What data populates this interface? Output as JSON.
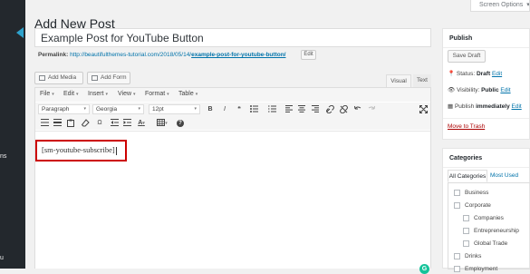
{
  "sidebar": {
    "frag1": "ns",
    "frag2": "u"
  },
  "header": {
    "title": "Add New Post",
    "screen_options": "Screen Options",
    "screen_options_caret": "▾"
  },
  "post": {
    "title": "Example Post for YouTube Button",
    "permalink_label": "Permalink:",
    "permalink_base": "http://beautifulthemes-tutorial.com/2018/05/14/",
    "permalink_slug": "example-post-for-youtube-button/",
    "edit_label": "Edit"
  },
  "media": {
    "add_media": "Add Media",
    "add_form": "Add Form"
  },
  "editor_tabs": {
    "visual": "Visual",
    "text": "Text"
  },
  "menubar": [
    "File",
    "Edit",
    "Insert",
    "View",
    "Format",
    "Table"
  ],
  "menubar_caret": "▾",
  "toolbar": {
    "format": "Paragraph",
    "font": "Georgia",
    "size": "12pt",
    "caret": "▾",
    "bold": "B",
    "italic": "I",
    "quote": "❝",
    "omega": "Ω",
    "text_color": "A",
    "help": "?"
  },
  "content": {
    "shortcode": "[sm-youtube-subscribe]",
    "grammarly": "G"
  },
  "publish": {
    "title": "Publish",
    "save_draft": "Save Draft",
    "status_label": "Status:",
    "status_value": "Draft",
    "visibility_label": "Visibility:",
    "visibility_value": "Public",
    "publish_label": "Publish",
    "publish_value": "immediately",
    "edit": "Edit",
    "trash": "Move to Trash"
  },
  "categories": {
    "title": "Categories",
    "tab_all": "All Categories",
    "tab_used": "Most Used",
    "items": [
      {
        "label": "Business",
        "level": 0
      },
      {
        "label": "Corporate",
        "level": 0
      },
      {
        "label": "Companies",
        "level": 1
      },
      {
        "label": "Entrepreneurship",
        "level": 1
      },
      {
        "label": "Global Trade",
        "level": 1
      },
      {
        "label": "Drinks",
        "level": 0
      },
      {
        "label": "Employment",
        "level": 0
      }
    ]
  },
  "colors": {
    "accent": "#0073aa",
    "sidebar": "#23282d",
    "highlight": "#cc0000",
    "trash": "#aa0000"
  }
}
